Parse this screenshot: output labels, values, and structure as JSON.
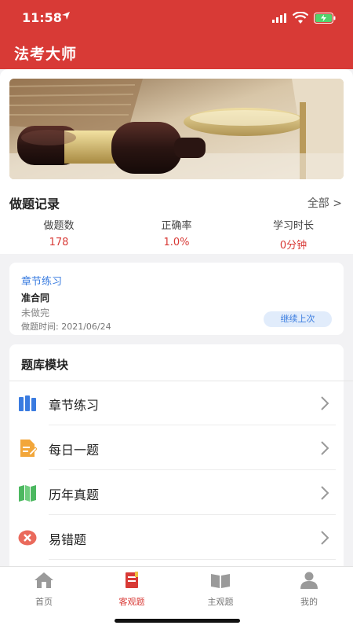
{
  "status_bar": {
    "time": "11:58"
  },
  "app": {
    "title": "法考大师",
    "accent": "#d83a36"
  },
  "record": {
    "title": "做题记录",
    "all_link": "全部 >",
    "stats": [
      {
        "label": "做题数",
        "value": "178"
      },
      {
        "label": "正确率",
        "value": "1.0%"
      },
      {
        "label": "学习时长",
        "value": "0分钟"
      }
    ]
  },
  "continue_card": {
    "section": "章节练习",
    "name": "准合同",
    "status": "未做完",
    "time": "做题时间: 2021/06/24",
    "button": "继续上次"
  },
  "modules": {
    "title": "题库模块",
    "items": [
      {
        "label": "章节练习",
        "icon": "books-icon"
      },
      {
        "label": "每日一题",
        "icon": "document-edit-icon"
      },
      {
        "label": "历年真题",
        "icon": "open-book-icon"
      },
      {
        "label": "易错题",
        "icon": "error-x-icon"
      }
    ]
  },
  "tabs": [
    {
      "label": "首页",
      "icon": "home-icon"
    },
    {
      "label": "客观题",
      "icon": "objective-book-icon",
      "active": true
    },
    {
      "label": "主观题",
      "icon": "subjective-book-icon"
    },
    {
      "label": "我的",
      "icon": "person-icon"
    }
  ]
}
